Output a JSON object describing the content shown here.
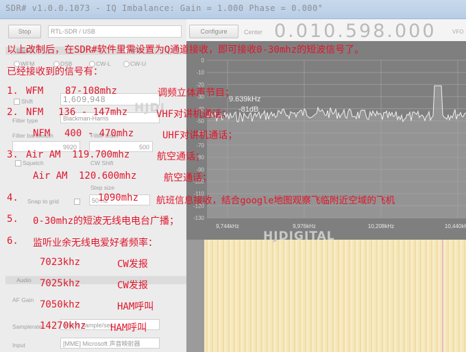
{
  "window": {
    "title": "SDR# v1.0.0.1073 - IQ Imbalance: Gain = 1.000 Phase = 0.000°"
  },
  "controls": {
    "stop_label": "Stop",
    "device_value": "RTL-SDR / USB",
    "configure_label": "Configure",
    "center_label": "Center",
    "frequency_display": "0.010.598.000",
    "vfo_label": "VFO",
    "radio_label": "Radio",
    "modes": [
      "WFM",
      "DSB",
      "CW-L",
      "CW-U",
      "USB"
    ],
    "shift_label": "Shift",
    "shift_value": "1,609,948",
    "filter_type_label": "Filter type",
    "filter_type_value": "Blackman-Harris",
    "filter_bandwidth_label": "Filter bandwidth",
    "filter_order_label": "Filter order",
    "bandwidth_value": "9920",
    "order_value": "500",
    "squelch_label": "Squelch",
    "cw_shift_label": "CW Shift",
    "step_size_label": "Step size",
    "snap_label": "Snap to grid",
    "step_value": "50 Hz",
    "audio_section": "Audio",
    "af_gain_label": "AF Gain",
    "samplerate_label": "Samplerate",
    "samplerate_value": "48000 sample/sec",
    "input_label": "Input",
    "input_value": "[MME] Microsoft 声音映射器"
  },
  "spectrum": {
    "y_ticks": [
      "0",
      "-10",
      "-20",
      "-30",
      "-40",
      "-50",
      "-60",
      "-70",
      "-80",
      "-90",
      "-100",
      "-110",
      "-120",
      "-130"
    ],
    "x_ticks": [
      "9,744kHz",
      "9,976kHz",
      "10,208kHz",
      "10,440kHz",
      "10,672kHz"
    ],
    "cursor_freq": "9.639kHz",
    "cursor_db": "-81dB",
    "watermark": "HJDIGITAL",
    "watermark_small": "HJDI"
  },
  "overlay": {
    "line1": "以上改制后，在SDR#软件里需设置为Q通道接收，即可接收0-30mhz的短波信号了。",
    "line2": "已经接收到的信号有：",
    "items": [
      {
        "num": "1.",
        "name": "WFM",
        "range": "87-108mhz",
        "desc": "调频立体声节目；"
      },
      {
        "num": "2.",
        "name": "NFM",
        "range": "136 - 147mhz",
        "desc": "VHF对讲机通话；"
      },
      {
        "num": "",
        "name": "NFM",
        "range": "400 - 470mhz",
        "desc": "UHF对讲机通话；"
      },
      {
        "num": "3.",
        "name": "Air AM",
        "range": "119.700mhz",
        "desc": "航空通话；"
      },
      {
        "num": "",
        "name": "Air AM",
        "range": "120.600mhz",
        "desc": "航空通话；"
      },
      {
        "num": "4.",
        "name": "",
        "range": "1090mhz",
        "desc": "航班信息接收，结合google地图观察飞临附近空域的飞机"
      },
      {
        "num": "5.",
        "name": "",
        "range": "0-30mhz的短波无线电电台广播；",
        "desc": ""
      },
      {
        "num": "6.",
        "name": "",
        "range": "监听业余无线电爱好者频率：",
        "desc": ""
      }
    ],
    "ham": [
      {
        "freq": "7023khz",
        "mode": "CW发报"
      },
      {
        "freq": "7025khz",
        "mode": "CW发报"
      },
      {
        "freq": "7050khz",
        "mode": "HAM呼叫"
      },
      {
        "freq": "14270khz",
        "mode": "HAM呼叫"
      }
    ]
  },
  "colors": {
    "overlay_text": "#e0152a",
    "spectrum_bg": "#7f7f7f",
    "waterfall": "#f4e2b0"
  }
}
